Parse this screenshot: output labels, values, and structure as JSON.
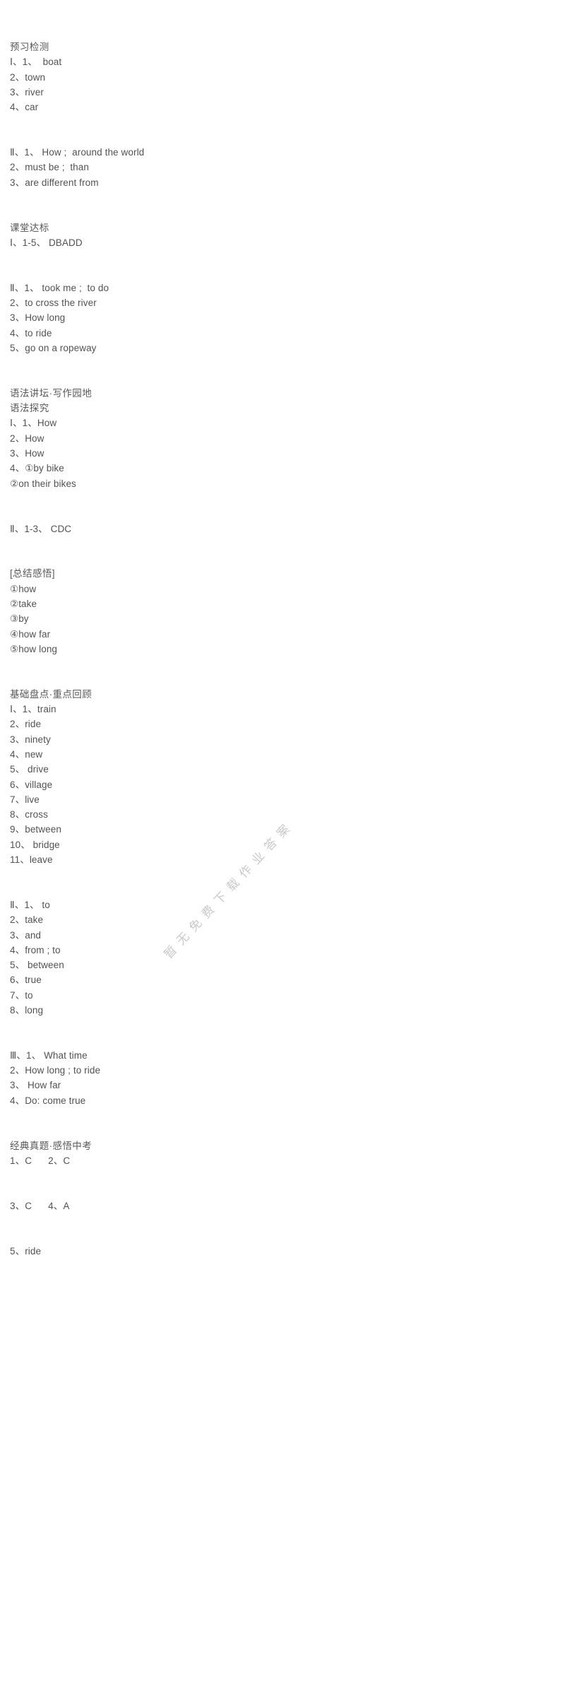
{
  "document": {
    "watermark": "暂无免费下载作业答案",
    "lines": [
      {
        "text": "预习检测",
        "cn": true
      },
      {
        "text": "Ⅰ、1、  boat",
        "cn": false
      },
      {
        "text": "2、town",
        "cn": false
      },
      {
        "text": "3、river",
        "cn": false
      },
      {
        "text": "4、car",
        "cn": false
      },
      {
        "text": "",
        "cn": false
      },
      {
        "text": "",
        "cn": false
      },
      {
        "text": "Ⅱ、1、 How ;  around the world",
        "cn": false
      },
      {
        "text": "2、must be ;  than",
        "cn": false
      },
      {
        "text": "3、are different from",
        "cn": false
      },
      {
        "text": "",
        "cn": false
      },
      {
        "text": "",
        "cn": false
      },
      {
        "text": "课堂达标",
        "cn": true
      },
      {
        "text": "Ⅰ、1-5、 DBADD",
        "cn": false
      },
      {
        "text": "",
        "cn": false
      },
      {
        "text": "",
        "cn": false
      },
      {
        "text": "Ⅱ、1、 took me ;  to do",
        "cn": false
      },
      {
        "text": "2、to cross the river",
        "cn": false
      },
      {
        "text": "3、How long",
        "cn": false
      },
      {
        "text": "4、to ride",
        "cn": false
      },
      {
        "text": "5、go on a ropeway",
        "cn": false
      },
      {
        "text": "",
        "cn": false
      },
      {
        "text": "",
        "cn": false
      },
      {
        "text": "语法讲坛·写作园地",
        "cn": true
      },
      {
        "text": "语法探究",
        "cn": true
      },
      {
        "text": "Ⅰ、1、How",
        "cn": false
      },
      {
        "text": "2、How",
        "cn": false
      },
      {
        "text": "3、How",
        "cn": false
      },
      {
        "text": "4、①by bike",
        "cn": false
      },
      {
        "text": "②on their bikes",
        "cn": false
      },
      {
        "text": "",
        "cn": false
      },
      {
        "text": "",
        "cn": false
      },
      {
        "text": "Ⅱ、1-3、 CDC",
        "cn": false
      },
      {
        "text": "",
        "cn": false
      },
      {
        "text": "",
        "cn": false
      },
      {
        "text": "[总结感悟]",
        "cn": true
      },
      {
        "text": "①how",
        "cn": false
      },
      {
        "text": "②take",
        "cn": false
      },
      {
        "text": "③by",
        "cn": false
      },
      {
        "text": "④how far",
        "cn": false
      },
      {
        "text": "⑤how long",
        "cn": false
      },
      {
        "text": "",
        "cn": false
      },
      {
        "text": "",
        "cn": false
      },
      {
        "text": "基础盘点·重点回顾",
        "cn": true
      },
      {
        "text": "Ⅰ、1、train",
        "cn": false
      },
      {
        "text": "2、ride",
        "cn": false
      },
      {
        "text": "3、ninety",
        "cn": false
      },
      {
        "text": "4、new",
        "cn": false
      },
      {
        "text": "5、 drive",
        "cn": false
      },
      {
        "text": "6、village",
        "cn": false
      },
      {
        "text": "7、live",
        "cn": false
      },
      {
        "text": "8、cross",
        "cn": false
      },
      {
        "text": "9、between",
        "cn": false
      },
      {
        "text": "10、 bridge",
        "cn": false
      },
      {
        "text": "11、leave",
        "cn": false
      },
      {
        "text": "",
        "cn": false
      },
      {
        "text": "",
        "cn": false
      },
      {
        "text": "Ⅱ、1、 to",
        "cn": false
      },
      {
        "text": "2、take",
        "cn": false
      },
      {
        "text": "3、and",
        "cn": false
      },
      {
        "text": "4、from ; to",
        "cn": false
      },
      {
        "text": "5、 between",
        "cn": false
      },
      {
        "text": "6、true",
        "cn": false
      },
      {
        "text": "7、to",
        "cn": false
      },
      {
        "text": "8、long",
        "cn": false
      },
      {
        "text": "",
        "cn": false
      },
      {
        "text": "",
        "cn": false
      },
      {
        "text": "Ⅲ、1、 What time",
        "cn": false
      },
      {
        "text": "2、How long ; to ride",
        "cn": false
      },
      {
        "text": "3、 How far",
        "cn": false
      },
      {
        "text": "4、Do: come true",
        "cn": false
      },
      {
        "text": "",
        "cn": false
      },
      {
        "text": "",
        "cn": false
      },
      {
        "text": "经典真题·感悟中考",
        "cn": true
      },
      {
        "text": "1、C      2、C",
        "cn": false
      },
      {
        "text": "",
        "cn": false
      },
      {
        "text": "",
        "cn": false
      },
      {
        "text": "3、C      4、A",
        "cn": false
      },
      {
        "text": "",
        "cn": false
      },
      {
        "text": "",
        "cn": false
      },
      {
        "text": "5、ride",
        "cn": false
      }
    ]
  }
}
